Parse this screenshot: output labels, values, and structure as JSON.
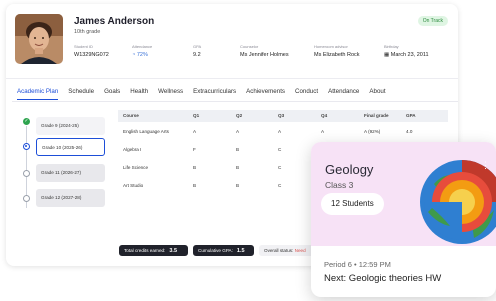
{
  "student": {
    "name": "James Anderson",
    "grade": "10th grade",
    "status": "On Track",
    "fields": [
      {
        "key": "Student ID",
        "value": "W1329NG072"
      },
      {
        "key": "Attendance",
        "value": "72%"
      },
      {
        "key": "GPA",
        "value": "9.2"
      },
      {
        "key": "Counselor",
        "value": "Ms Jennifer Holmes"
      },
      {
        "key": "Homeroom advisor",
        "value": "Ms Elizabeth Rock"
      },
      {
        "key": "Birthday",
        "value": "March 23, 2011"
      }
    ]
  },
  "tabs": [
    "Academic Plan",
    "Schedule",
    "Goals",
    "Health",
    "Wellness",
    "Extracurriculars",
    "Achievements",
    "Conduct",
    "Attendance",
    "About"
  ],
  "timeline": [
    {
      "label": "Grade 9 (2024-25)",
      "state": "done"
    },
    {
      "label": "Grade 10 (2025-26)",
      "state": "current"
    },
    {
      "label": "Grade 11 (2026-27)",
      "state": "upcoming"
    },
    {
      "label": "Grade 12 (2027-28)",
      "state": "upcoming"
    }
  ],
  "table": {
    "headers": [
      "Course",
      "Q1",
      "Q2",
      "Q3",
      "Q4",
      "Final grade",
      "GPA"
    ],
    "rows": [
      [
        "English Language Arts",
        "A",
        "A",
        "A",
        "A",
        "A (92%)",
        "4.0"
      ],
      [
        "Algebra I",
        "F",
        "B",
        "C",
        "",
        "",
        ""
      ],
      [
        "Life Science",
        "B",
        "B",
        "C",
        "",
        "",
        ""
      ],
      [
        "Art Studio",
        "B",
        "B",
        "C",
        "",
        "",
        ""
      ]
    ]
  },
  "footer": {
    "credits_label": "Total credits earned:",
    "credits_value": "3.5",
    "gpa_label": "Cumulative GPA:",
    "gpa_value": "1.5",
    "overall_label": "Overall status:",
    "overall_value": "Need"
  },
  "class_card": {
    "title": "Geology",
    "subtitle": "Class 3",
    "students": "12 Students",
    "period": "Period 6 • 12:59 PM",
    "next": "Next: Geologic theories HW",
    "menu_icon": "kebab-menu-icon",
    "bg_color": "#f7e2f6"
  }
}
